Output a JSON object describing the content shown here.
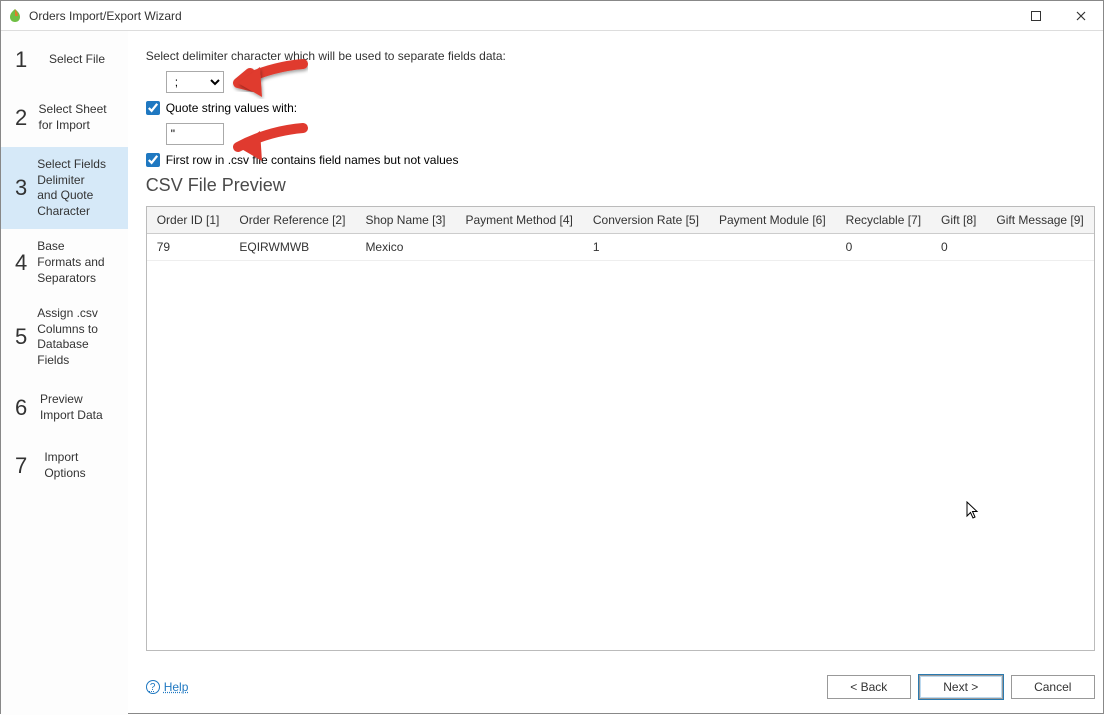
{
  "window": {
    "title": "Orders Import/Export Wizard"
  },
  "sidebar": {
    "steps": [
      {
        "num": "1",
        "label": "Select File"
      },
      {
        "num": "2",
        "label": "Select Sheet for Import"
      },
      {
        "num": "3",
        "label": "Select Fields Delimiter and Quote Character"
      },
      {
        "num": "4",
        "label": "Base Formats and Separators"
      },
      {
        "num": "5",
        "label": "Assign .csv Columns to Database Fields"
      },
      {
        "num": "6",
        "label": "Preview Import Data"
      },
      {
        "num": "7",
        "label": "Import Options"
      }
    ],
    "active_index": 2
  },
  "main": {
    "delimiter_instruction": "Select delimiter character which will be used to separate fields data:",
    "delimiter_value": ";",
    "quote_enabled": true,
    "quote_label": "Quote string values with:",
    "quote_value": "\"",
    "first_row_enabled": true,
    "first_row_label": "First row in .csv file contains field names but not values",
    "preview_title": "CSV File Preview",
    "columns": [
      "Order ID [1]",
      "Order Reference [2]",
      "Shop Name [3]",
      "Payment Method [4]",
      "Conversion Rate [5]",
      "Payment Module [6]",
      "Recyclable [7]",
      "Gift [8]",
      "Gift Message [9]"
    ],
    "rows": [
      {
        "c0": "79",
        "c1": "EQIRWMWB",
        "c2": "Mexico",
        "c3": "",
        "c4": "1",
        "c5": "",
        "c6": "0",
        "c7": "0",
        "c8": ""
      }
    ]
  },
  "footer": {
    "help": "Help",
    "back": "< Back",
    "next": "Next >",
    "cancel": "Cancel"
  }
}
